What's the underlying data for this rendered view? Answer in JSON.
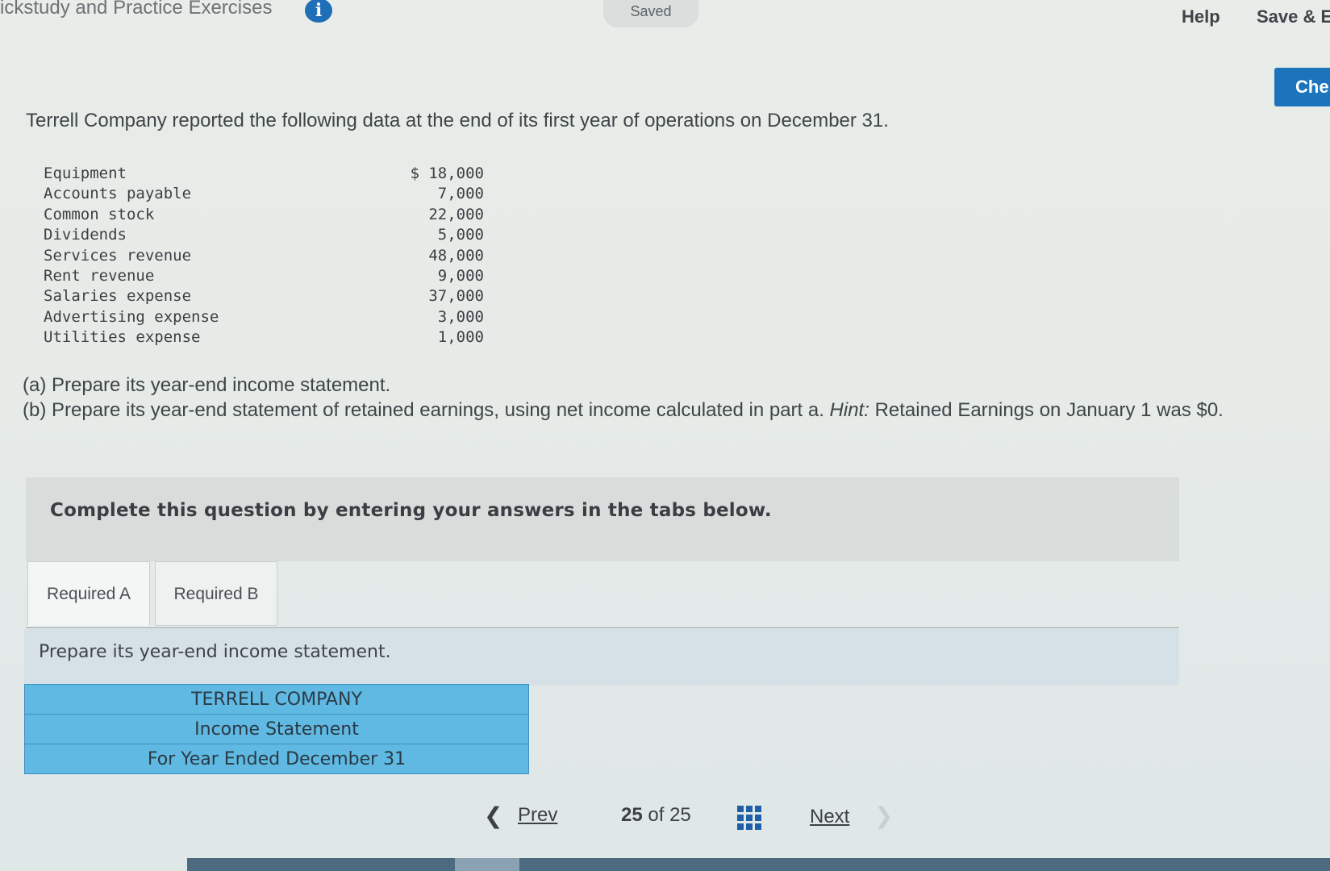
{
  "header": {
    "app_title": "ickstudy and Practice Exercises",
    "info_icon": "i",
    "saved_status": "Saved",
    "help_label": "Help",
    "save_exit_label": "Save & E",
    "check_label": "Che"
  },
  "problem": {
    "intro": "Terrell Company reported the following data at the end of its first year of operations on December 31.",
    "accounts": [
      {
        "name": "Equipment",
        "amount": "$ 18,000"
      },
      {
        "name": "Accounts payable",
        "amount": "7,000"
      },
      {
        "name": "Common stock",
        "amount": "22,000"
      },
      {
        "name": "Dividends",
        "amount": "5,000"
      },
      {
        "name": "Services revenue",
        "amount": "48,000"
      },
      {
        "name": "Rent revenue",
        "amount": "9,000"
      },
      {
        "name": "Salaries expense",
        "amount": "37,000"
      },
      {
        "name": "Advertising expense",
        "amount": "3,000"
      },
      {
        "name": "Utilities expense",
        "amount": "1,000"
      }
    ],
    "part_a": "(a) Prepare its year-end income statement.",
    "part_b_prefix": "(b) Prepare its year-end statement of retained earnings, using net income calculated in part a. ",
    "part_b_hint_label": "Hint:",
    "part_b_suffix": " Retained Earnings on January 1 was $0."
  },
  "question": {
    "complete_text": "Complete this question by entering your answers in the tabs below.",
    "tabs": [
      {
        "label": "Required A",
        "active": true
      },
      {
        "label": "Required B",
        "active": false
      }
    ],
    "prompt": "Prepare its year-end income statement."
  },
  "statement": {
    "company": "TERRELL COMPANY",
    "title": "Income Statement",
    "period": "For Year Ended December 31"
  },
  "pager": {
    "prev_label": "Prev",
    "current": "25",
    "of_label": "of",
    "total": "25",
    "next_label": "Next"
  },
  "icons": {
    "prev": "chevron-left-icon",
    "next": "chevron-right-icon",
    "grid": "grid-icon",
    "info": "info-icon"
  }
}
